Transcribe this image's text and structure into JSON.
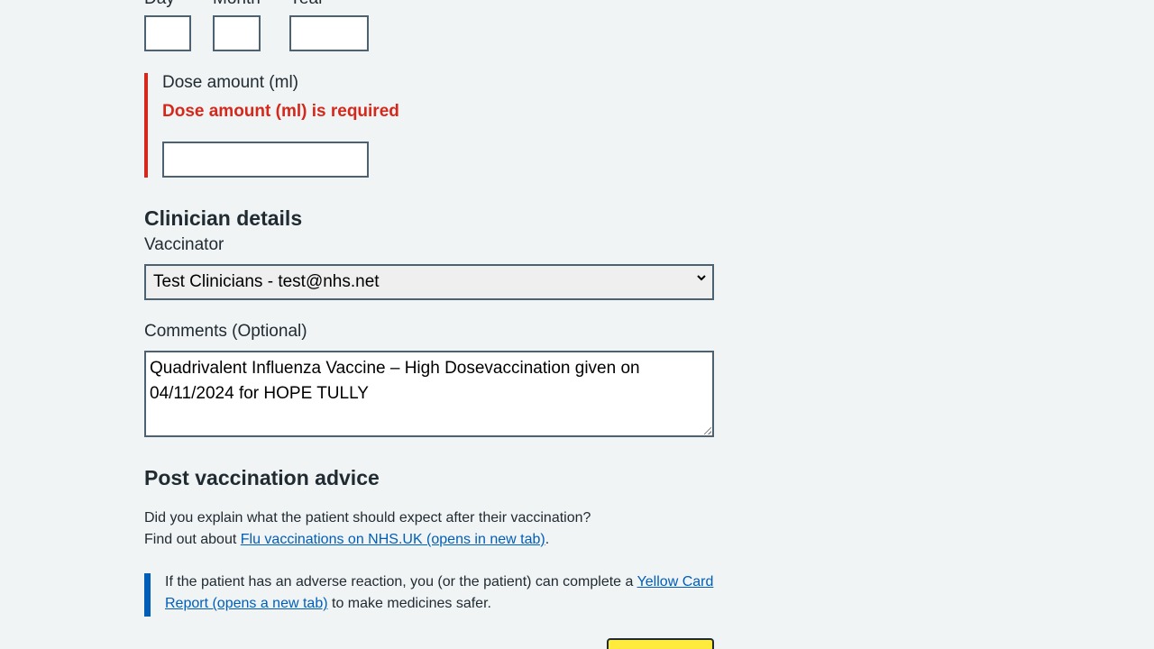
{
  "date": {
    "day_label": "Day",
    "month_label": "Month",
    "year_label": "Year"
  },
  "dose": {
    "label": "Dose amount (ml)",
    "error": "Dose amount (ml) is required",
    "value": ""
  },
  "clinician": {
    "heading": "Clinician details",
    "vaccinator_label": "Vaccinator",
    "vaccinator_value": "Test Clinicians - test@nhs.net"
  },
  "comments": {
    "label": "Comments (Optional)",
    "value": "Quadrivalent Influenza Vaccine – High Dosevaccination given on 04/11/2024 for HOPE TULLY"
  },
  "advice": {
    "heading": "Post vaccination advice",
    "question": "Did you explain what the patient should expect after their vaccination?",
    "find_out_prefix": "Find out about ",
    "find_out_link": "Flu vaccinations on NHS.UK (opens in new tab)",
    "find_out_suffix": ".",
    "inset_prefix": "If the patient has an adverse reaction, you (or the patient) can complete a ",
    "inset_link": "Yellow Card Report (opens a new tab)",
    "inset_suffix": " to make medicines safer."
  },
  "colors": {
    "background": "#f0f4f5",
    "error": "#d5281b",
    "link": "#005eb8",
    "button": "#ffeb3b"
  }
}
